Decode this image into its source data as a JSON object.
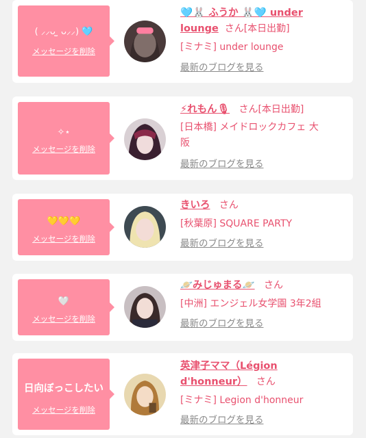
{
  "common": {
    "delete_label": "メッセージを削除",
    "blog_label": "最新のブログを見る"
  },
  "colors": {
    "accent": "#e8506e",
    "bubble": "#ff8fa3",
    "background": "#f2f2f2"
  },
  "entries": [
    {
      "message": "( ⸝⸝ᴗ ̫ ᴗ⸝⸝) 🩵",
      "name_line1": "🩵🐰 ふうか 🐰🩵 under",
      "name_line2": "lounge",
      "suffix": "さん[本日出勤]",
      "shop": "[ミナミ] under lounge",
      "avatar_icon": "avatar-photo-icon"
    },
    {
      "message": "✧⋆",
      "name": "⚡れもん🎙",
      "suffix": "さん[本日出勤]",
      "shop_line1": "[日本橋] メイドロックカフェ 大",
      "shop_line2": "阪",
      "avatar_icon": "avatar-photo-icon"
    },
    {
      "message": "💛💛💛",
      "name": "きいろ",
      "suffix": "さん",
      "shop": "[秋葉原] SQUARE PARTY",
      "avatar_icon": "avatar-photo-icon"
    },
    {
      "message": "🤍",
      "name": "🪐みじゅまる🪐",
      "suffix": "さん",
      "shop": "[中洲] エンジェル女学園 3年2組",
      "avatar_icon": "avatar-photo-icon"
    },
    {
      "message": "日向ぼっこしたい",
      "name_line1": "英津子ママ（Légion",
      "name_line2": "d'honneur）",
      "suffix": "さん",
      "shop": "[ミナミ] Legion d'honneur",
      "avatar_icon": "avatar-photo-icon"
    }
  ]
}
